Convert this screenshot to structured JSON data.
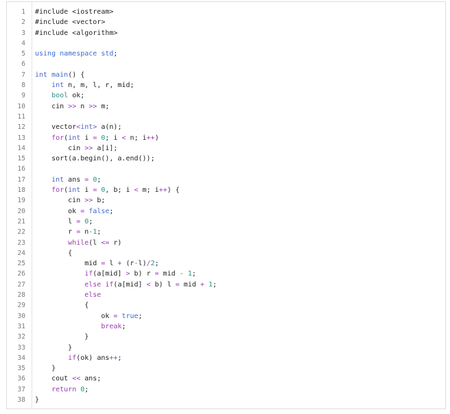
{
  "editor": {
    "lines": [
      {
        "n": "1",
        "tokens": [
          [
            "pp",
            "#include <iostream>"
          ]
        ]
      },
      {
        "n": "2",
        "tokens": [
          [
            "pp",
            "#include <vector>"
          ]
        ]
      },
      {
        "n": "3",
        "tokens": [
          [
            "pp",
            "#include <algorithm>"
          ]
        ]
      },
      {
        "n": "4",
        "tokens": []
      },
      {
        "n": "5",
        "tokens": [
          [
            "kw",
            "using namespace"
          ],
          [
            "plain",
            " "
          ],
          [
            "kw",
            "std"
          ],
          [
            "plain",
            ";"
          ]
        ]
      },
      {
        "n": "6",
        "tokens": []
      },
      {
        "n": "7",
        "tokens": [
          [
            "type",
            "int"
          ],
          [
            "plain",
            " "
          ],
          [
            "kw",
            "main"
          ],
          [
            "plain",
            "() {"
          ]
        ]
      },
      {
        "n": "8",
        "tokens": [
          [
            "plain",
            "    "
          ],
          [
            "type",
            "int"
          ],
          [
            "plain",
            " n, m, l, r, mid;"
          ]
        ]
      },
      {
        "n": "9",
        "tokens": [
          [
            "plain",
            "    "
          ],
          [
            "ty2",
            "bool"
          ],
          [
            "plain",
            " ok;"
          ]
        ]
      },
      {
        "n": "10",
        "tokens": [
          [
            "plain",
            "    cin "
          ],
          [
            "op",
            ">>"
          ],
          [
            "plain",
            " n "
          ],
          [
            "op",
            ">>"
          ],
          [
            "plain",
            " m;"
          ]
        ]
      },
      {
        "n": "11",
        "tokens": []
      },
      {
        "n": "12",
        "tokens": [
          [
            "plain",
            "    vector"
          ],
          [
            "op",
            "<"
          ],
          [
            "type",
            "int"
          ],
          [
            "op",
            ">"
          ],
          [
            "plain",
            " a(n);"
          ]
        ]
      },
      {
        "n": "13",
        "tokens": [
          [
            "plain",
            "    "
          ],
          [
            "ctrl",
            "for"
          ],
          [
            "plain",
            "("
          ],
          [
            "type",
            "int"
          ],
          [
            "plain",
            " i "
          ],
          [
            "op",
            "="
          ],
          [
            "plain",
            " "
          ],
          [
            "num",
            "0"
          ],
          [
            "plain",
            "; i "
          ],
          [
            "op",
            "<"
          ],
          [
            "plain",
            " n; i"
          ],
          [
            "op",
            "++"
          ],
          [
            "plain",
            ")"
          ]
        ]
      },
      {
        "n": "14",
        "tokens": [
          [
            "plain",
            "        cin "
          ],
          [
            "op",
            ">>"
          ],
          [
            "plain",
            " a[i];"
          ]
        ]
      },
      {
        "n": "15",
        "tokens": [
          [
            "plain",
            "    sort(a.begin(), a.end());"
          ]
        ]
      },
      {
        "n": "16",
        "tokens": []
      },
      {
        "n": "17",
        "tokens": [
          [
            "plain",
            "    "
          ],
          [
            "type",
            "int"
          ],
          [
            "plain",
            " ans "
          ],
          [
            "op",
            "="
          ],
          [
            "plain",
            " "
          ],
          [
            "num",
            "0"
          ],
          [
            "plain",
            ";"
          ]
        ]
      },
      {
        "n": "18",
        "tokens": [
          [
            "plain",
            "    "
          ],
          [
            "ctrl",
            "for"
          ],
          [
            "plain",
            "("
          ],
          [
            "type",
            "int"
          ],
          [
            "plain",
            " i "
          ],
          [
            "op",
            "="
          ],
          [
            "plain",
            " "
          ],
          [
            "num",
            "0"
          ],
          [
            "plain",
            ", b; i "
          ],
          [
            "op",
            "<"
          ],
          [
            "plain",
            " m; i"
          ],
          [
            "op",
            "++"
          ],
          [
            "plain",
            ") {"
          ]
        ]
      },
      {
        "n": "19",
        "tokens": [
          [
            "plain",
            "        cin "
          ],
          [
            "op",
            ">>"
          ],
          [
            "plain",
            " b;"
          ]
        ]
      },
      {
        "n": "20",
        "tokens": [
          [
            "plain",
            "        ok "
          ],
          [
            "op",
            "="
          ],
          [
            "plain",
            " "
          ],
          [
            "lit",
            "false"
          ],
          [
            "plain",
            ";"
          ]
        ]
      },
      {
        "n": "21",
        "tokens": [
          [
            "plain",
            "        l "
          ],
          [
            "op",
            "="
          ],
          [
            "plain",
            " "
          ],
          [
            "num",
            "0"
          ],
          [
            "plain",
            ";"
          ]
        ]
      },
      {
        "n": "22",
        "tokens": [
          [
            "plain",
            "        r "
          ],
          [
            "op",
            "="
          ],
          [
            "plain",
            " n"
          ],
          [
            "op",
            "-"
          ],
          [
            "num",
            "1"
          ],
          [
            "plain",
            ";"
          ]
        ]
      },
      {
        "n": "23",
        "tokens": [
          [
            "plain",
            "        "
          ],
          [
            "ctrl",
            "while"
          ],
          [
            "plain",
            "(l "
          ],
          [
            "op",
            "<="
          ],
          [
            "plain",
            " r)"
          ]
        ]
      },
      {
        "n": "24",
        "tokens": [
          [
            "plain",
            "        {"
          ]
        ]
      },
      {
        "n": "25",
        "tokens": [
          [
            "plain",
            "            mid "
          ],
          [
            "op",
            "="
          ],
          [
            "plain",
            " l "
          ],
          [
            "op",
            "+"
          ],
          [
            "plain",
            " (r"
          ],
          [
            "op",
            "-"
          ],
          [
            "plain",
            "l)"
          ],
          [
            "op",
            "/"
          ],
          [
            "num",
            "2"
          ],
          [
            "plain",
            ";"
          ]
        ]
      },
      {
        "n": "26",
        "tokens": [
          [
            "plain",
            "            "
          ],
          [
            "ctrl",
            "if"
          ],
          [
            "plain",
            "(a[mid] "
          ],
          [
            "op",
            ">"
          ],
          [
            "plain",
            " b) r "
          ],
          [
            "op",
            "="
          ],
          [
            "plain",
            " mid "
          ],
          [
            "op",
            "-"
          ],
          [
            "plain",
            " "
          ],
          [
            "num",
            "1"
          ],
          [
            "plain",
            ";"
          ]
        ]
      },
      {
        "n": "27",
        "tokens": [
          [
            "plain",
            "            "
          ],
          [
            "ctrl",
            "else"
          ],
          [
            "plain",
            " "
          ],
          [
            "ctrl",
            "if"
          ],
          [
            "plain",
            "(a[mid] "
          ],
          [
            "op",
            "<"
          ],
          [
            "plain",
            " b) l "
          ],
          [
            "op",
            "="
          ],
          [
            "plain",
            " mid "
          ],
          [
            "op",
            "+"
          ],
          [
            "plain",
            " "
          ],
          [
            "num",
            "1"
          ],
          [
            "plain",
            ";"
          ]
        ]
      },
      {
        "n": "28",
        "tokens": [
          [
            "plain",
            "            "
          ],
          [
            "ctrl",
            "else"
          ]
        ]
      },
      {
        "n": "29",
        "tokens": [
          [
            "plain",
            "            {"
          ]
        ]
      },
      {
        "n": "30",
        "tokens": [
          [
            "plain",
            "                ok "
          ],
          [
            "op",
            "="
          ],
          [
            "plain",
            " "
          ],
          [
            "lit",
            "true"
          ],
          [
            "plain",
            ";"
          ]
        ]
      },
      {
        "n": "31",
        "tokens": [
          [
            "plain",
            "                "
          ],
          [
            "ctrl",
            "break"
          ],
          [
            "plain",
            ";"
          ]
        ]
      },
      {
        "n": "32",
        "tokens": [
          [
            "plain",
            "            }"
          ]
        ]
      },
      {
        "n": "33",
        "tokens": [
          [
            "plain",
            "        }"
          ]
        ]
      },
      {
        "n": "34",
        "tokens": [
          [
            "plain",
            "        "
          ],
          [
            "ctrl",
            "if"
          ],
          [
            "plain",
            "(ok) ans"
          ],
          [
            "op",
            "++"
          ],
          [
            "plain",
            ";"
          ]
        ]
      },
      {
        "n": "35",
        "tokens": [
          [
            "plain",
            "    }"
          ]
        ]
      },
      {
        "n": "36",
        "tokens": [
          [
            "plain",
            "    cout "
          ],
          [
            "op",
            "<<"
          ],
          [
            "plain",
            " ans;"
          ]
        ]
      },
      {
        "n": "37",
        "tokens": [
          [
            "plain",
            "    "
          ],
          [
            "ctrl",
            "return"
          ],
          [
            "plain",
            " "
          ],
          [
            "num",
            "0"
          ],
          [
            "plain",
            ";"
          ]
        ]
      },
      {
        "n": "38",
        "tokens": [
          [
            "plain",
            "}"
          ]
        ]
      }
    ]
  }
}
